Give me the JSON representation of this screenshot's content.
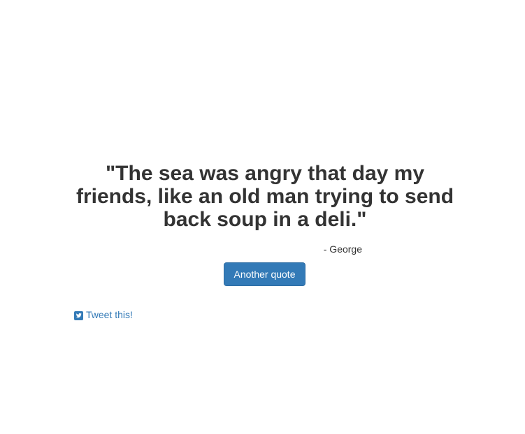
{
  "quote": {
    "text": "\"The sea was angry that day my friends, like an old man trying to send back soup in a deli.\"",
    "author": "- George"
  },
  "actions": {
    "another_quote_label": "Another quote",
    "tweet_label": "Tweet this!",
    "tweet_icon": "twitter-square-icon"
  },
  "colors": {
    "accent": "#337ab7",
    "text": "#333333",
    "background": "#ffffff"
  }
}
